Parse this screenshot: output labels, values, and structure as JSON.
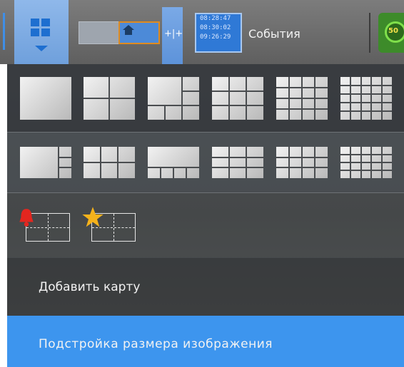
{
  "toolbar": {
    "events_label": "События",
    "clock_lines": [
      "08:28:47",
      "08:30:02",
      "09:26:29"
    ],
    "gauge_text": "50",
    "splitter_glyph": "+|+"
  },
  "layouts": {
    "row1": [
      "1x1",
      "2x2",
      "1+5",
      "3x3",
      "4x4",
      "5x5"
    ],
    "row2": [
      "wide-1+3",
      "wide-2x3",
      "wide-1+4",
      "wide-3x3",
      "wide-3x4",
      "wide-4x5"
    ],
    "special": [
      "alarm-layout",
      "favorite-layout"
    ]
  },
  "menu": {
    "add_map": "Добавить карту",
    "fit_image": "Подстройка размера изображения"
  },
  "colors": {
    "accent": "#3d95ee",
    "toolbar": "#6e6e6e",
    "panel": "#4a4d50"
  }
}
